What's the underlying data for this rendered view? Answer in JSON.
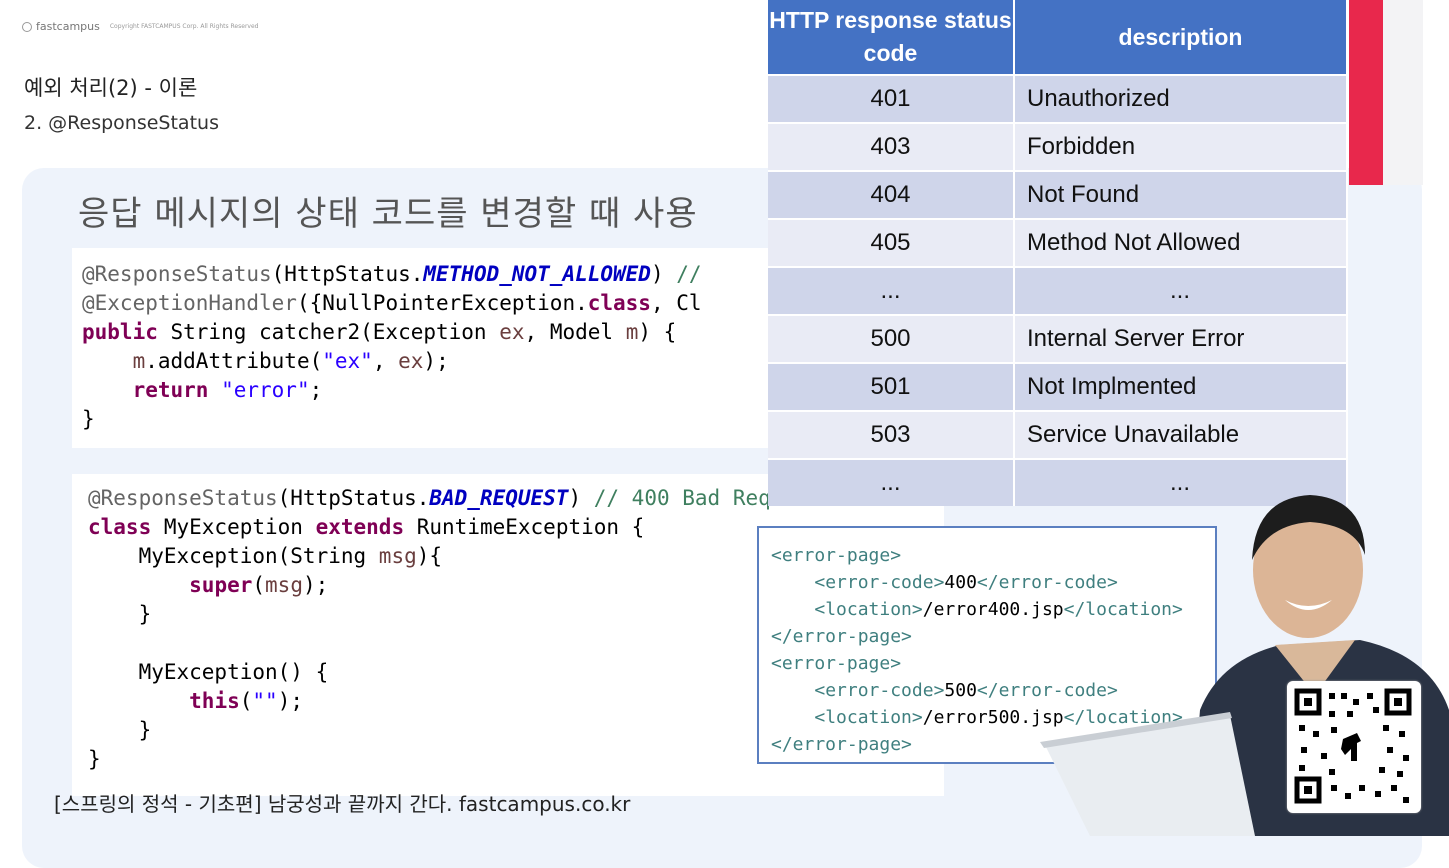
{
  "brand": {
    "name": "fastcampus",
    "copyright": "Copyright FASTCAMPUS Corp. All Rights Reserved"
  },
  "title": "예외 처리(2) - 이론",
  "subtitle": "2. @ResponseStatus",
  "heading": "응답 메시지의 상태 코드를 변경할 때 사용",
  "code1": [
    "@ResponseStatus(HttpStatus.METHOD_NOT_ALLOWED) //",
    "@ExceptionHandler({NullPointerException.class, Cl",
    "public String catcher2(Exception ex, Model m) {",
    "    m.addAttribute(\"ex\", ex);",
    "    return \"error\";",
    "}"
  ],
  "code2": [
    "@ResponseStatus(HttpStatus.BAD_REQUEST) // 400 Bad Request.",
    "class MyException extends RuntimeException {",
    "    MyException(String msg){",
    "        super(msg);",
    "    }",
    "",
    "    MyException() {",
    "        this(\"\");",
    "    }",
    "}"
  ],
  "status_table": {
    "headers": [
      "HTTP response status code",
      "description"
    ],
    "rows": [
      {
        "code": "401",
        "description": "Unauthorized"
      },
      {
        "code": "403",
        "description": "Forbidden"
      },
      {
        "code": "404",
        "description": "Not Found"
      },
      {
        "code": "405",
        "description": "Method Not Allowed"
      },
      {
        "code": "...",
        "description": "..."
      },
      {
        "code": "500",
        "description": "Internal Server Error"
      },
      {
        "code": "501",
        "description": "Not Implmented"
      },
      {
        "code": "503",
        "description": "Service Unavailable"
      },
      {
        "code": "...",
        "description": "..."
      }
    ]
  },
  "xml": [
    "<error-page>",
    "    <error-code>400</error-code>",
    "    <location>/error400.jsp</location>",
    "</error-page>",
    "<error-page>",
    "    <error-code>500</error-code>",
    "    <location>/error500.jsp</location>",
    "</error-page>"
  ],
  "footer": "[스프링의 정석 - 기초편] 남궁성과 끝까지 간다.  fastcampus.co.kr",
  "colors": {
    "table_header": "#4472c4",
    "accent_red": "#e8284c",
    "panel_bg": "#eef3fb"
  }
}
